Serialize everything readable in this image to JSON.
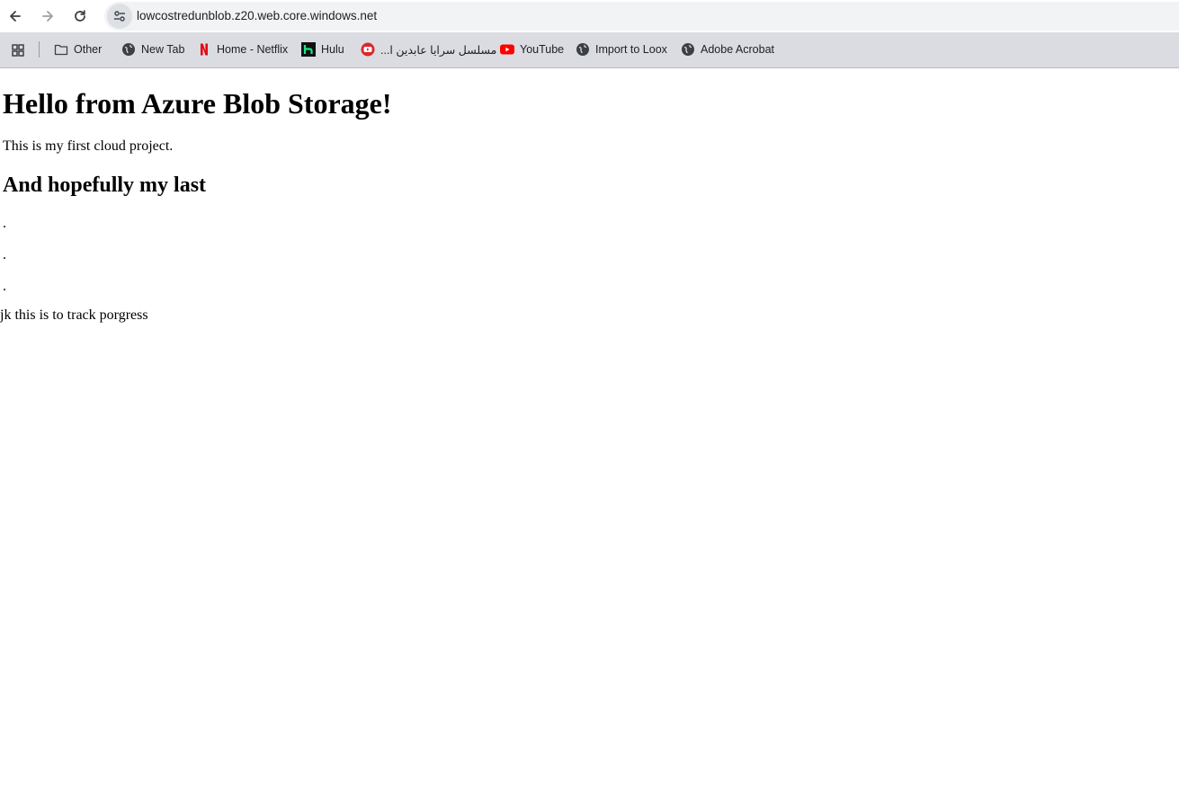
{
  "browser": {
    "url": "lowcostredunblob.z20.web.core.windows.net",
    "nav": {
      "back_icon": "arrow-left-icon",
      "forward_icon": "arrow-right-icon",
      "reload_icon": "reload-icon",
      "site_info_icon": "tune-icon"
    },
    "bookmarks": [
      {
        "label": "Other",
        "icon": "folder-icon"
      },
      {
        "label": "New Tab",
        "icon": "globe-icon"
      },
      {
        "label": "Home - Netflix",
        "icon": "netflix-icon"
      },
      {
        "label": "Hulu",
        "icon": "hulu-icon"
      },
      {
        "label": "مسلسل سرايا عابدين ا...",
        "icon": "youtube-circle-icon"
      },
      {
        "label": "YouTube",
        "icon": "youtube-icon"
      },
      {
        "label": "Import to Loox",
        "icon": "globe-icon"
      },
      {
        "label": "Adobe Acrobat",
        "icon": "globe-icon"
      }
    ],
    "colors": {
      "bookmarks_bar": "#dadce1",
      "omnibox": "#f1f3f4",
      "netflix": "#e50914",
      "hulu": "#1ce783",
      "youtube": "#ff0000"
    }
  },
  "page": {
    "heading": "Hello from Azure Blob Storage!",
    "intro": "This is my first cloud project.",
    "subheading": "And hopefully my last",
    "dots": [
      ".",
      ".",
      "."
    ],
    "footer": "jk this is to track porgress"
  }
}
